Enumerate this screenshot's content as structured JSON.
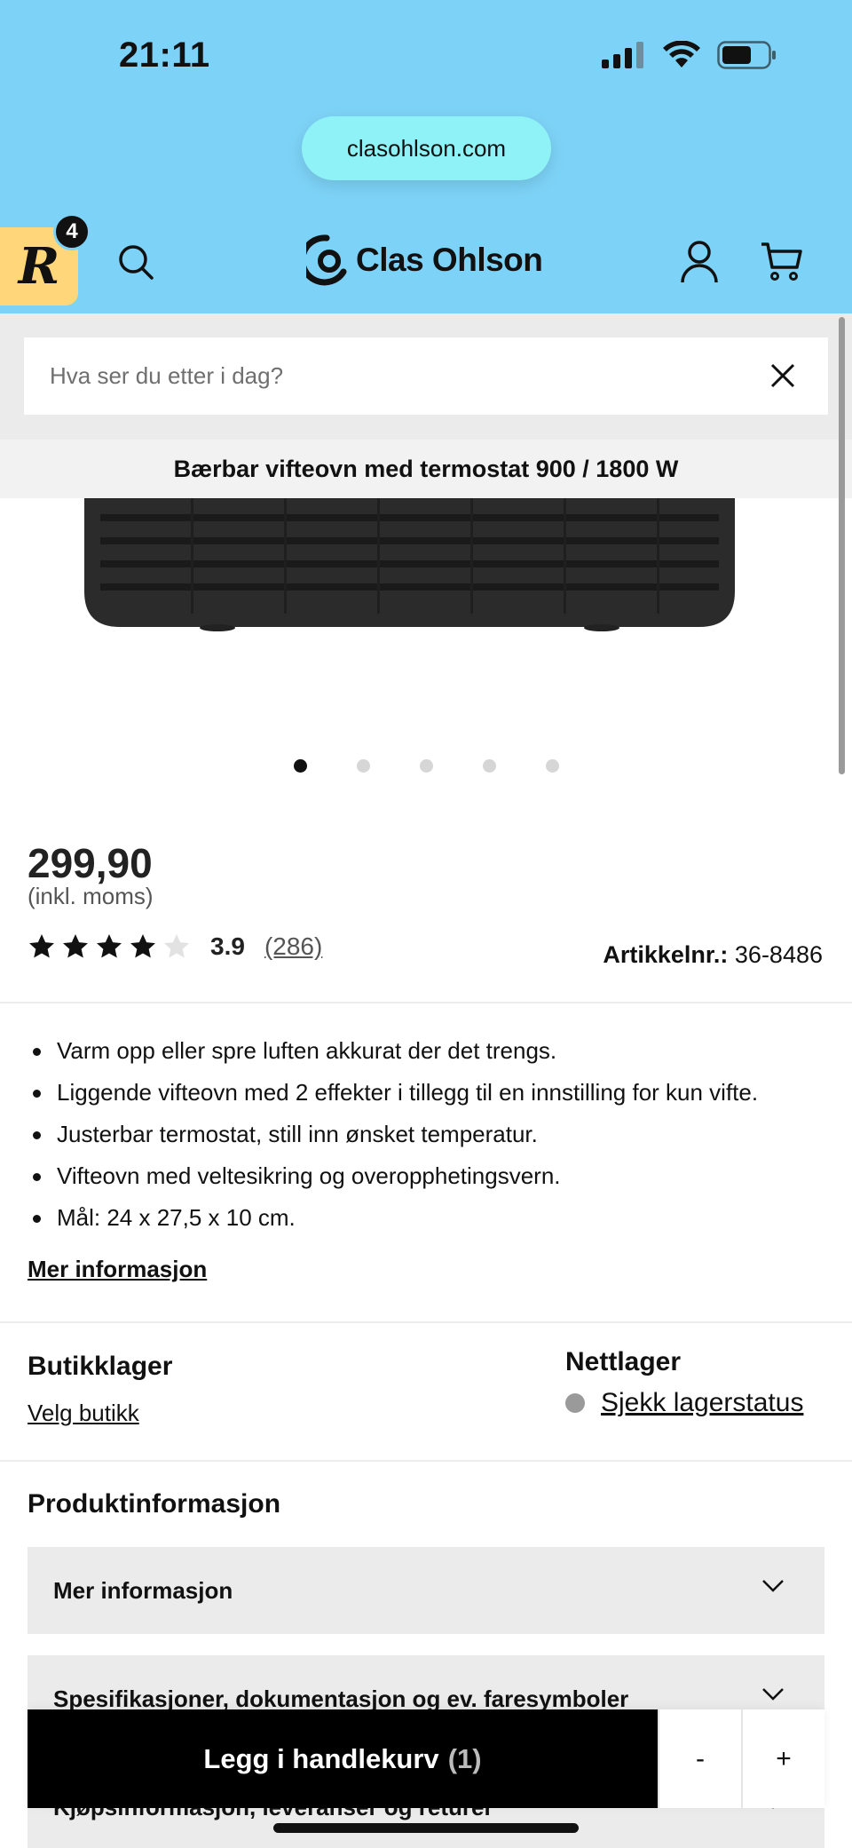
{
  "status": {
    "time": "21:11"
  },
  "browser": {
    "url": "clasohlson.com"
  },
  "header": {
    "badge_letter": "R",
    "badge_count": "4",
    "logo_text": "Clas Ohlson"
  },
  "search": {
    "placeholder": "Hva ser du etter i dag?"
  },
  "product": {
    "title": "Bærbar vifteovn med termostat 900 / 1800 W",
    "image_count": 5,
    "active_image_index": 0,
    "price": "299,90",
    "vat_note": "(inkl. moms)",
    "rating": {
      "value": "3.9",
      "count": "(286)",
      "stars_filled": 4,
      "stars_total": 5
    },
    "article_label": "Artikkelnr.:",
    "article_number": "36-8486",
    "bullets": [
      "Varm opp eller spre luften akkurat der det trengs.",
      "Liggende vifteovn med 2 effekter i tillegg til en innstilling for kun vifte.",
      "Justerbar termostat, still inn ønsket temperatur.",
      "Vifteovn med veltesikring og overopphetingsvern.",
      "Mål: 24 x 27,5 x 10 cm."
    ],
    "more_info_link": "Mer informasjon"
  },
  "stock": {
    "store_heading": "Butikklager",
    "store_link": "Velg butikk",
    "online_heading": "Nettlager",
    "online_link": "Sjekk lagerstatus"
  },
  "product_info": {
    "heading": "Produktinformasjon",
    "sections": [
      "Mer informasjon",
      "Spesifikasjoner, dokumentasjon og ev. faresymboler",
      "Kjøpsinformasjon, leveranser og returer"
    ]
  },
  "cart": {
    "add_label": "Legg i handlekurv",
    "quantity": "(1)",
    "minus": "-",
    "plus": "+"
  },
  "colors": {
    "header_bg": "#7dd3f7",
    "url_pill": "#8ff2f6",
    "badge": "#ffd77a"
  }
}
